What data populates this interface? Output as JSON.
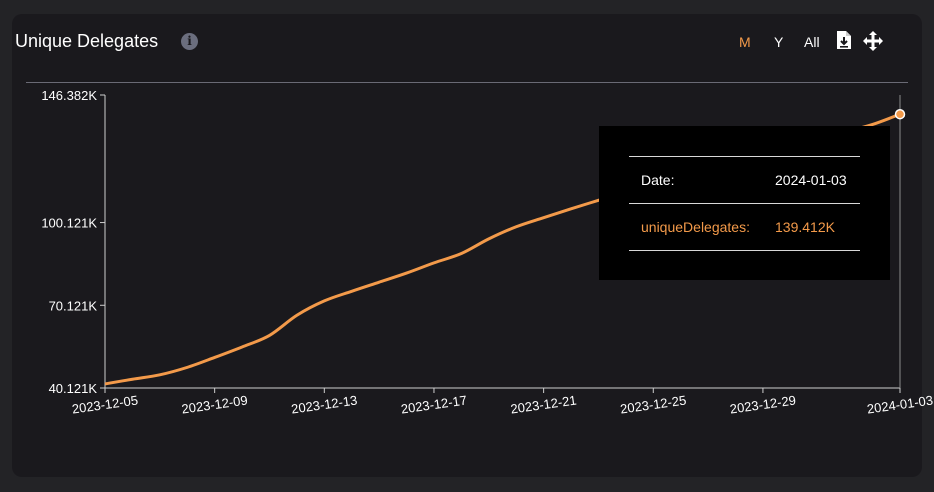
{
  "header": {
    "title": "Unique Delegates",
    "info_icon": "info-icon",
    "ranges": [
      "M",
      "Y",
      "All"
    ],
    "active_range": "M",
    "download_icon": "download-icon",
    "pan_icon": "pan-icon"
  },
  "colors": {
    "series": "#f39a4a",
    "active_range": "#f39a4a",
    "axis": "#cfcfcf"
  },
  "tooltip": {
    "date_label": "Date:",
    "date_value": "2024-01-03",
    "series_label": "uniqueDelegates:",
    "series_value": "139.412K"
  },
  "chart_data": {
    "type": "line",
    "title": "Unique Delegates",
    "xlabel": "",
    "ylabel": "",
    "x_tick_labels": [
      "2023-12-05",
      "2023-12-09",
      "2023-12-13",
      "2023-12-17",
      "2023-12-21",
      "2023-12-25",
      "2023-12-29",
      "2024-01-03"
    ],
    "y_tick_labels": [
      "146.382K",
      "100.121K",
      "70.121K",
      "40.121K"
    ],
    "y_ticks": [
      146382,
      100121,
      70121,
      40121
    ],
    "ylim": [
      40121,
      146382
    ],
    "grid": false,
    "series": [
      {
        "name": "uniqueDelegates",
        "x": [
          "2023-12-05",
          "2023-12-06",
          "2023-12-07",
          "2023-12-08",
          "2023-12-09",
          "2023-12-10",
          "2023-12-11",
          "2023-12-12",
          "2023-12-13",
          "2023-12-14",
          "2023-12-15",
          "2023-12-16",
          "2023-12-17",
          "2023-12-18",
          "2023-12-19",
          "2023-12-20",
          "2023-12-21",
          "2023-12-22",
          "2023-12-23",
          "2023-12-24",
          "2023-12-25",
          "2023-12-26",
          "2023-12-27",
          "2023-12-28",
          "2023-12-29",
          "2023-12-30",
          "2023-12-31",
          "2024-01-01",
          "2024-01-02",
          "2024-01-03"
        ],
        "values": [
          41600,
          43300,
          44900,
          47600,
          51200,
          55000,
          59200,
          66500,
          71700,
          75200,
          78500,
          81800,
          85500,
          88900,
          94200,
          98600,
          101900,
          105100,
          108200,
          111300,
          114300,
          117200,
          120000,
          122700,
          125300,
          127900,
          130500,
          133000,
          135700,
          139412
        ]
      }
    ]
  }
}
